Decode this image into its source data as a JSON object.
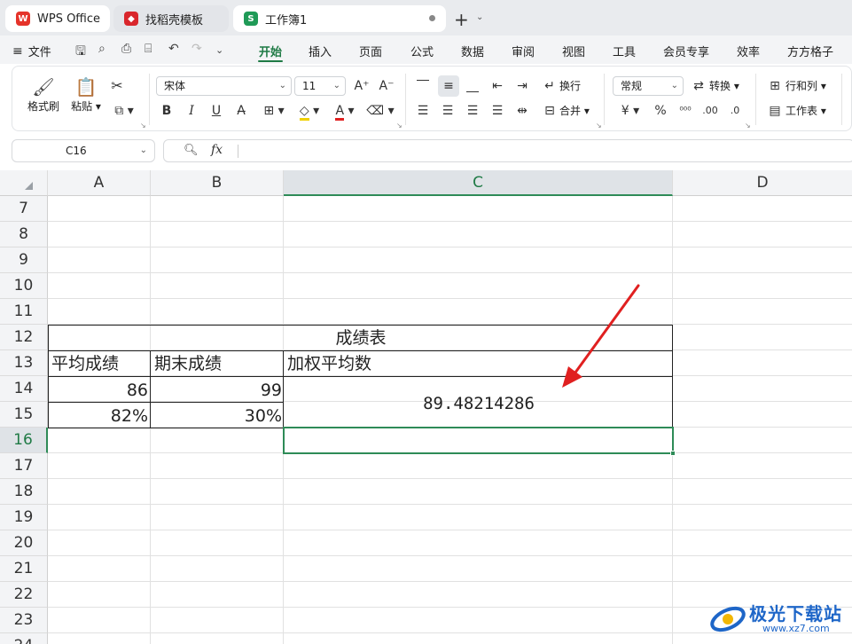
{
  "tabs": [
    {
      "label": "WPS Office",
      "icon": "wps-logo-icon"
    },
    {
      "label": "找稻壳模板",
      "icon": "docer-icon"
    },
    {
      "label": "工作簿1",
      "icon": "spreadsheet-s-icon"
    }
  ],
  "menu": {
    "file_label": "文件",
    "items": [
      "开始",
      "插入",
      "页面",
      "公式",
      "数据",
      "审阅",
      "视图",
      "工具",
      "会员专享",
      "效率",
      "方方格子"
    ],
    "active": "开始"
  },
  "ribbon": {
    "format_painter": "格式刷",
    "paste": "粘贴",
    "font_name": "宋体",
    "font_size": "11",
    "wrap": "换行",
    "merge": "合并",
    "number_format": "常规",
    "convert": "转换",
    "rowcol": "行和列",
    "worksheet": "工作表",
    "currency_symbol": "¥",
    "percent_symbol": "%"
  },
  "formula_bar": {
    "name_box": "C16",
    "fx": "fx",
    "value": ""
  },
  "grid": {
    "columns": [
      "A",
      "B",
      "C",
      "D"
    ],
    "selected_column": "C",
    "rows": [
      "7",
      "8",
      "9",
      "10",
      "11",
      "12",
      "13",
      "14",
      "15",
      "16",
      "17",
      "18",
      "19",
      "20",
      "21",
      "22",
      "23",
      "24"
    ],
    "selected_row": "16"
  },
  "table": {
    "title": "成绩表",
    "header_a": "平均成绩",
    "header_b": "期末成绩",
    "header_c": "加权平均数",
    "r14_a": "86",
    "r14_b": "99",
    "r15_a": "82%",
    "r15_b": "30%",
    "result": "89.48214286"
  },
  "colors": {
    "accent": "#1f7a45",
    "arrow": "#e02020"
  },
  "watermark": {
    "name": "极光下载站",
    "url": "www.xz7.com"
  }
}
